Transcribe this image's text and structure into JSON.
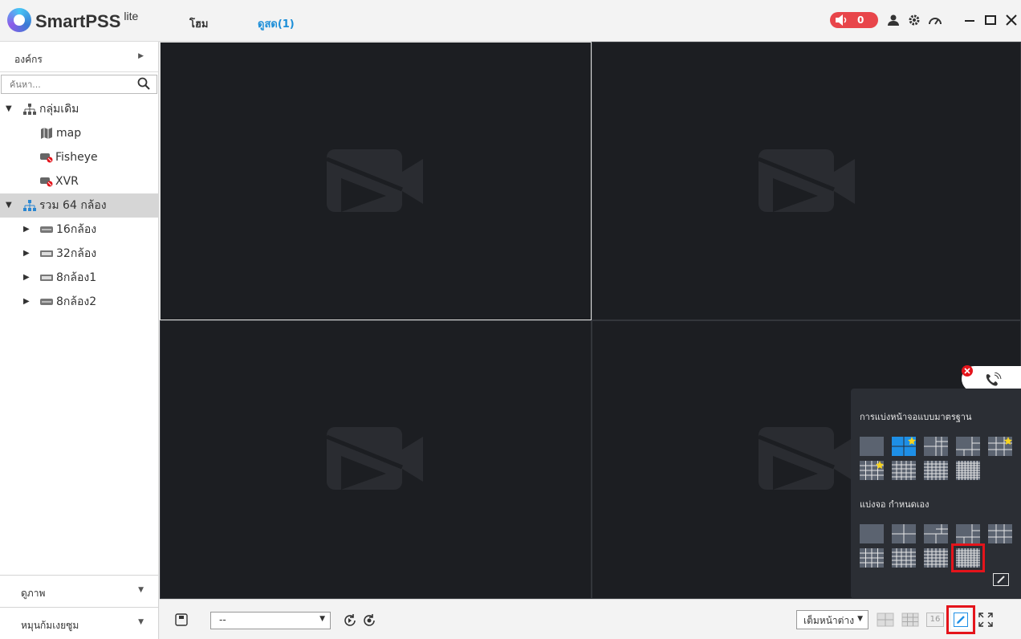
{
  "app": {
    "name": "SmartPSS",
    "suffix": "lite"
  },
  "menu": {
    "home": "โฮม",
    "live": "ดูสด(1)"
  },
  "alarm": {
    "count": "0"
  },
  "sidebar": {
    "org_label": "องค์กร",
    "search_placeholder": "ค้นหา...",
    "tree": [
      {
        "label": "กลุ่มเดิม",
        "type": "group",
        "expanded": true
      },
      {
        "label": "map",
        "type": "map"
      },
      {
        "label": "Fisheye",
        "type": "camera-offline"
      },
      {
        "label": "XVR",
        "type": "camera-offline"
      },
      {
        "label": "รวม 64 กล้อง",
        "type": "group",
        "expanded": true,
        "selected": true
      },
      {
        "label": "16กล้อง",
        "type": "nvr"
      },
      {
        "label": "32กล้อง",
        "type": "nvr"
      },
      {
        "label": "8กล้อง1",
        "type": "nvr"
      },
      {
        "label": "8กล้อง2",
        "type": "nvr"
      }
    ],
    "panel_view": "ดูภาพ",
    "panel_ptz": "หมุนก้มเงยซูม"
  },
  "toolbar": {
    "preset_value": "--",
    "fit_value": "เต็มหน้าต่าง",
    "layout_16": "16"
  },
  "layout_popup": {
    "standard_title": "การแบ่งหน้าจอแบบมาตรฐาน",
    "custom_title": "แบ่งจอ กำหนดเอง"
  },
  "colors": {
    "accent": "#1c8ed8",
    "alarm": "#e8454a",
    "highlight": "#e4141b"
  }
}
